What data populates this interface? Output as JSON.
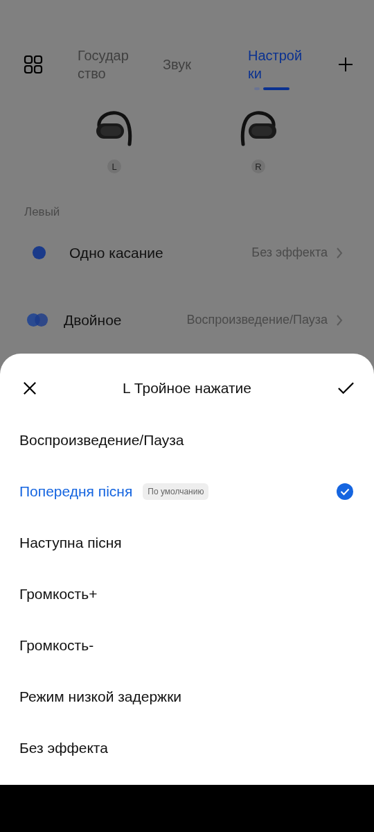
{
  "tabs": [
    {
      "label": "Государ ство",
      "selected": false
    },
    {
      "label": "Звук",
      "selected": false
    },
    {
      "label": "Настрой ки",
      "selected": true
    }
  ],
  "pager": [
    {
      "selected": false
    },
    {
      "selected": true
    }
  ],
  "earbuds": [
    {
      "side": "L",
      "kind": "left"
    },
    {
      "side": "R",
      "kind": "right"
    }
  ],
  "section": "Левый",
  "gestures": [
    {
      "kind": "single",
      "label": "Одно касание",
      "value": "Без эффекта"
    },
    {
      "kind": "double",
      "label": "Двойное",
      "value": "Воспроизведение/Пауза"
    }
  ],
  "sheet": {
    "title": "L Тройное нажатие",
    "options": [
      {
        "label": "Воспроизведение/Пауза",
        "selected": false
      },
      {
        "label": "Попередня пісня",
        "selected": true,
        "badge": "По умолчанию"
      },
      {
        "label": "Наступна пісня",
        "selected": false
      },
      {
        "label": "Громкость+",
        "selected": false
      },
      {
        "label": "Громкость-",
        "selected": false
      },
      {
        "label": "Режим низкой задержки",
        "selected": false
      },
      {
        "label": "Без эффекта",
        "selected": false
      }
    ]
  }
}
